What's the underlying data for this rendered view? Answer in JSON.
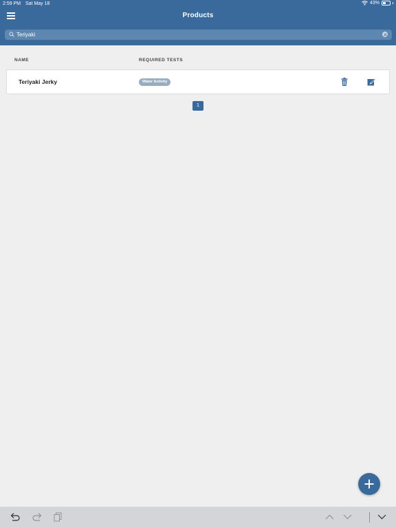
{
  "status_bar": {
    "time": "2:59 PM",
    "date": "Sat May 18",
    "battery_text": "43%",
    "battery_level": 0.43
  },
  "header": {
    "title": "Products"
  },
  "search": {
    "value": "Teriyaki",
    "placeholder": ""
  },
  "table": {
    "columns": [
      "NAME",
      "REQUIRED TESTS"
    ],
    "rows": [
      {
        "name": "Teriyaki Jerky",
        "tests": [
          "Water Activity"
        ]
      }
    ]
  },
  "pagination": {
    "current_page": "1"
  },
  "colors": {
    "primary": "#3a6a9c",
    "background": "#efefef",
    "badge": "#9aacbf"
  },
  "icons": {
    "menu": "hamburger-icon",
    "search": "search-icon",
    "clear": "clear-icon",
    "delete": "trash-icon",
    "edit": "edit-icon",
    "add": "plus-icon",
    "undo": "undo-icon",
    "redo": "redo-icon",
    "paste": "paste-icon",
    "up": "chevron-up-icon",
    "down": "chevron-down-icon",
    "dismiss": "keyboard-dismiss-icon"
  }
}
